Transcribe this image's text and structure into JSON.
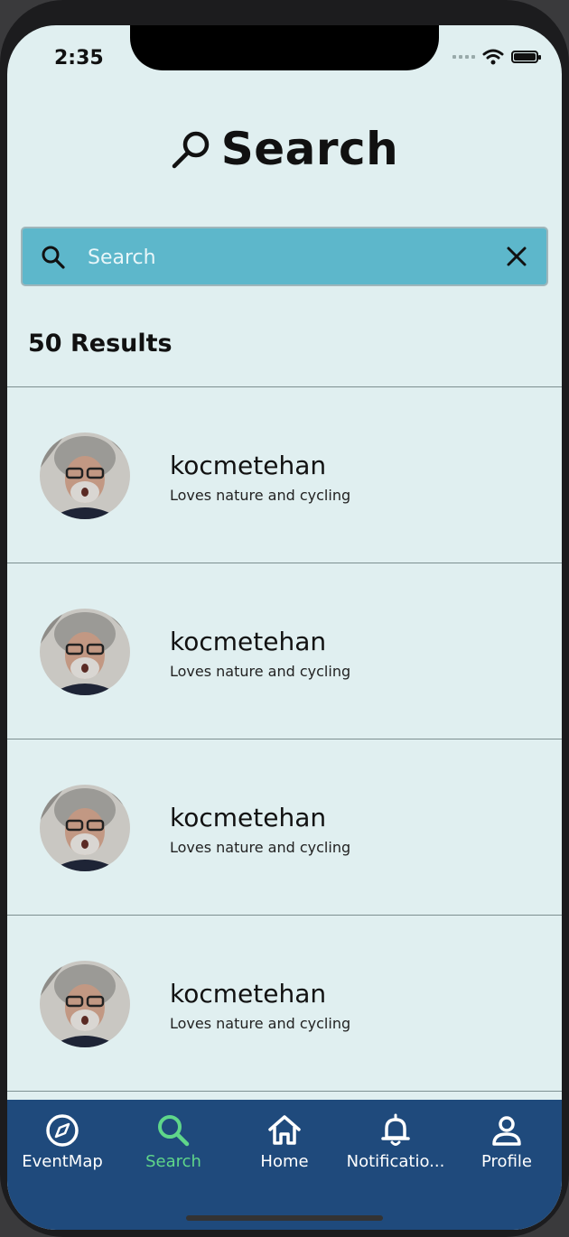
{
  "status_bar": {
    "time": "2:35"
  },
  "header": {
    "title": "Search"
  },
  "search": {
    "placeholder": "Search",
    "value": ""
  },
  "results": {
    "count_label": "50 Results",
    "items": [
      {
        "username": "kocmetehan",
        "bio": "Loves nature and cycling"
      },
      {
        "username": "kocmetehan",
        "bio": "Loves nature and cycling"
      },
      {
        "username": "kocmetehan",
        "bio": "Loves nature and cycling"
      },
      {
        "username": "kocmetehan",
        "bio": "Loves nature and cycling"
      }
    ]
  },
  "tab_bar": {
    "tabs": [
      {
        "label": "EventMap",
        "icon": "compass-icon",
        "active": false
      },
      {
        "label": "Search",
        "icon": "search-icon",
        "active": true
      },
      {
        "label": "Home",
        "icon": "home-icon",
        "active": false
      },
      {
        "label": "Notificatio...",
        "icon": "bell-icon",
        "active": false
      },
      {
        "label": "Profile",
        "icon": "person-icon",
        "active": false
      }
    ]
  },
  "colors": {
    "background": "#e0eff0",
    "search_bar": "#5db7cb",
    "tab_bar": "#1f4a7c",
    "active_tab": "#5fd68a"
  }
}
